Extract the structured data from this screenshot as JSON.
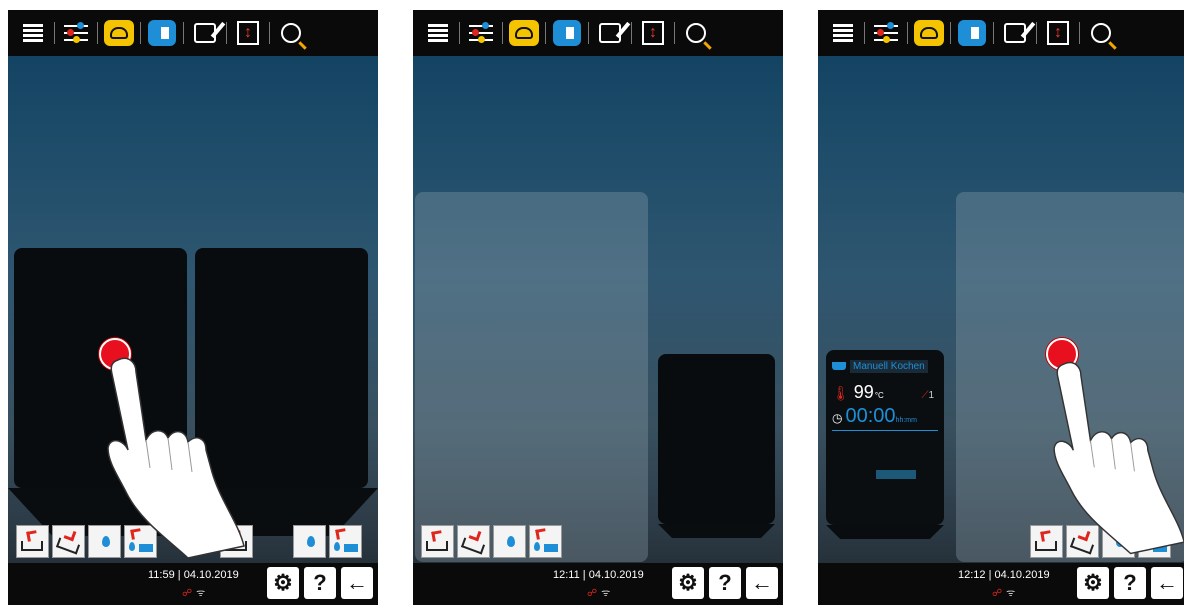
{
  "screens": [
    {
      "time": "11:59",
      "date": "04.10.2019"
    },
    {
      "time": "12:11",
      "date": "04.10.2019"
    },
    {
      "time": "12:12",
      "date": "04.10.2019",
      "card": {
        "title": "Manuell Kochen",
        "temperature": "99",
        "temperature_unit": "°C",
        "probe_count": "1",
        "timer": "00:00",
        "timer_unit": "hh:mm"
      }
    }
  ],
  "bottombar": {
    "help_label": "?",
    "back_label": "←",
    "settings_label": "⚙"
  },
  "colors": {
    "accent_blue": "#1e8fd6",
    "accent_yellow": "#f5c400",
    "touch_red": "#e8101e"
  }
}
